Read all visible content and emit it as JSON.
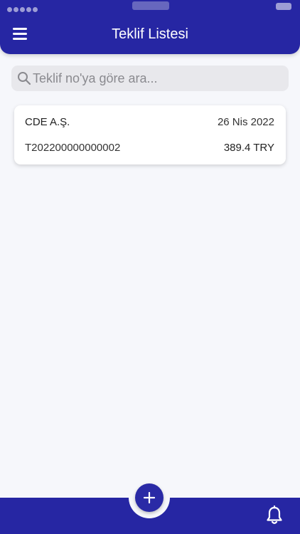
{
  "header": {
    "title": "Teklif Listesi",
    "menu_icon": "hamburger-menu-icon"
  },
  "search": {
    "placeholder": "Teklif no'ya göre ara...",
    "value": "",
    "icon": "search-icon"
  },
  "offers": [
    {
      "company": "CDE A.Ş.",
      "date": "26 Nis 2022",
      "offer_no": "T202200000000002",
      "amount": "389.4 TRY"
    }
  ],
  "bottom_bar": {
    "fab_icon": "plus-icon",
    "notification_icon": "bell-icon"
  },
  "colors": {
    "primary": "#2626a3",
    "background": "#f6f7fb",
    "search_bg": "#e8e8ec",
    "card_bg": "#ffffff"
  }
}
